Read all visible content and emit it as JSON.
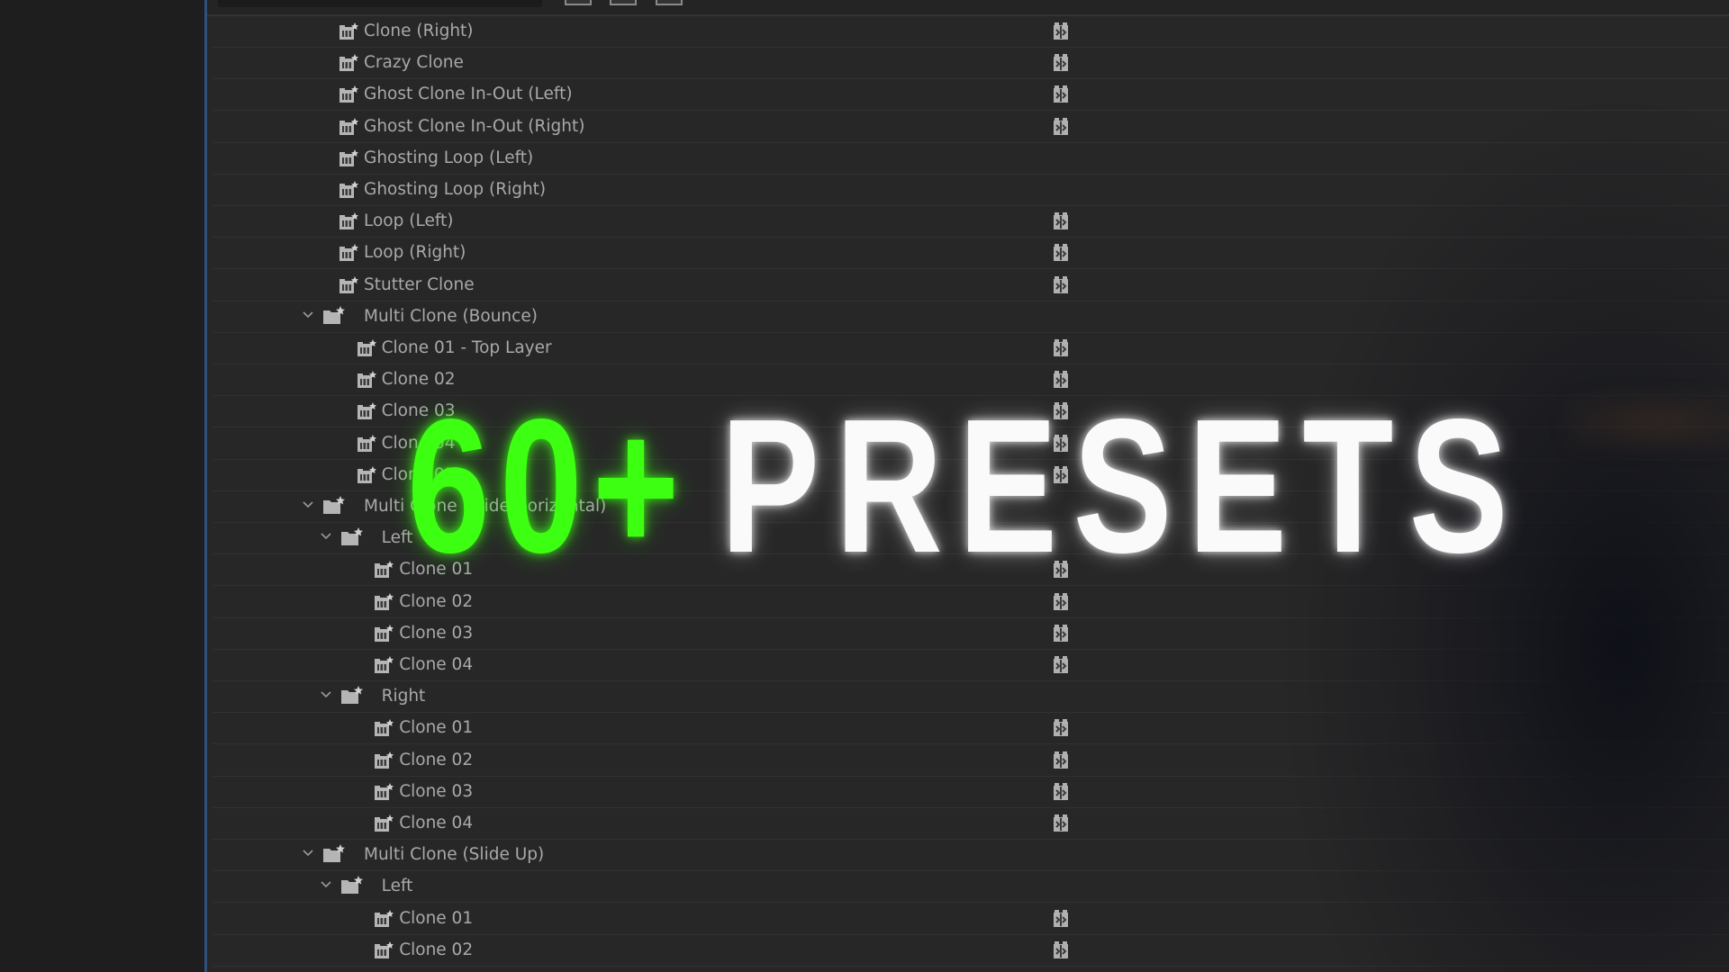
{
  "overlay": {
    "number": "60+",
    "word": "PRESETS",
    "number_color": "#3dff12",
    "word_color": "#ffffff"
  },
  "accent": {
    "panel_border": "#2f4f7c"
  },
  "tree": [
    {
      "label": "Clone (Right)",
      "depth": 0,
      "type": "preset",
      "accelerated": true
    },
    {
      "label": "Crazy Clone",
      "depth": 0,
      "type": "preset",
      "accelerated": true
    },
    {
      "label": "Ghost Clone In-Out (Left)",
      "depth": 0,
      "type": "preset",
      "accelerated": true
    },
    {
      "label": "Ghost Clone In-Out (Right)",
      "depth": 0,
      "type": "preset",
      "accelerated": true
    },
    {
      "label": "Ghosting Loop (Left)",
      "depth": 0,
      "type": "preset",
      "accelerated": false
    },
    {
      "label": "Ghosting Loop (Right)",
      "depth": 0,
      "type": "preset",
      "accelerated": false
    },
    {
      "label": "Loop (Left)",
      "depth": 0,
      "type": "preset",
      "accelerated": true
    },
    {
      "label": "Loop (Right)",
      "depth": 0,
      "type": "preset",
      "accelerated": true
    },
    {
      "label": "Stutter Clone",
      "depth": 0,
      "type": "preset",
      "accelerated": true
    },
    {
      "label": "Multi Clone (Bounce)",
      "depth": 0,
      "type": "folder",
      "expanded": true
    },
    {
      "label": "Clone 01 - Top Layer",
      "depth": 1,
      "type": "preset",
      "accelerated": true
    },
    {
      "label": "Clone 02",
      "depth": 1,
      "type": "preset",
      "accelerated": true
    },
    {
      "label": "Clone 03",
      "depth": 1,
      "type": "preset",
      "accelerated": true
    },
    {
      "label": "Clone 04",
      "depth": 1,
      "type": "preset",
      "accelerated": true
    },
    {
      "label": "Clone 05",
      "depth": 1,
      "type": "preset",
      "accelerated": true
    },
    {
      "label": "Multi Clone (Slide Horizontal)",
      "depth": 0,
      "type": "folder",
      "expanded": true
    },
    {
      "label": "Left",
      "depth": 1,
      "type": "folder",
      "expanded": true
    },
    {
      "label": "Clone 01",
      "depth": 2,
      "type": "preset",
      "accelerated": true
    },
    {
      "label": "Clone 02",
      "depth": 2,
      "type": "preset",
      "accelerated": true
    },
    {
      "label": "Clone 03",
      "depth": 2,
      "type": "preset",
      "accelerated": true
    },
    {
      "label": "Clone 04",
      "depth": 2,
      "type": "preset",
      "accelerated": true
    },
    {
      "label": "Right",
      "depth": 1,
      "type": "folder",
      "expanded": true
    },
    {
      "label": "Clone 01",
      "depth": 2,
      "type": "preset",
      "accelerated": true
    },
    {
      "label": "Clone 02",
      "depth": 2,
      "type": "preset",
      "accelerated": true
    },
    {
      "label": "Clone 03",
      "depth": 2,
      "type": "preset",
      "accelerated": true
    },
    {
      "label": "Clone 04",
      "depth": 2,
      "type": "preset",
      "accelerated": true
    },
    {
      "label": "Multi Clone (Slide Up)",
      "depth": 0,
      "type": "folder",
      "expanded": true
    },
    {
      "label": "Left",
      "depth": 1,
      "type": "folder",
      "expanded": true
    },
    {
      "label": "Clone 01",
      "depth": 2,
      "type": "preset",
      "accelerated": true
    },
    {
      "label": "Clone 02",
      "depth": 2,
      "type": "preset",
      "accelerated": true
    }
  ]
}
